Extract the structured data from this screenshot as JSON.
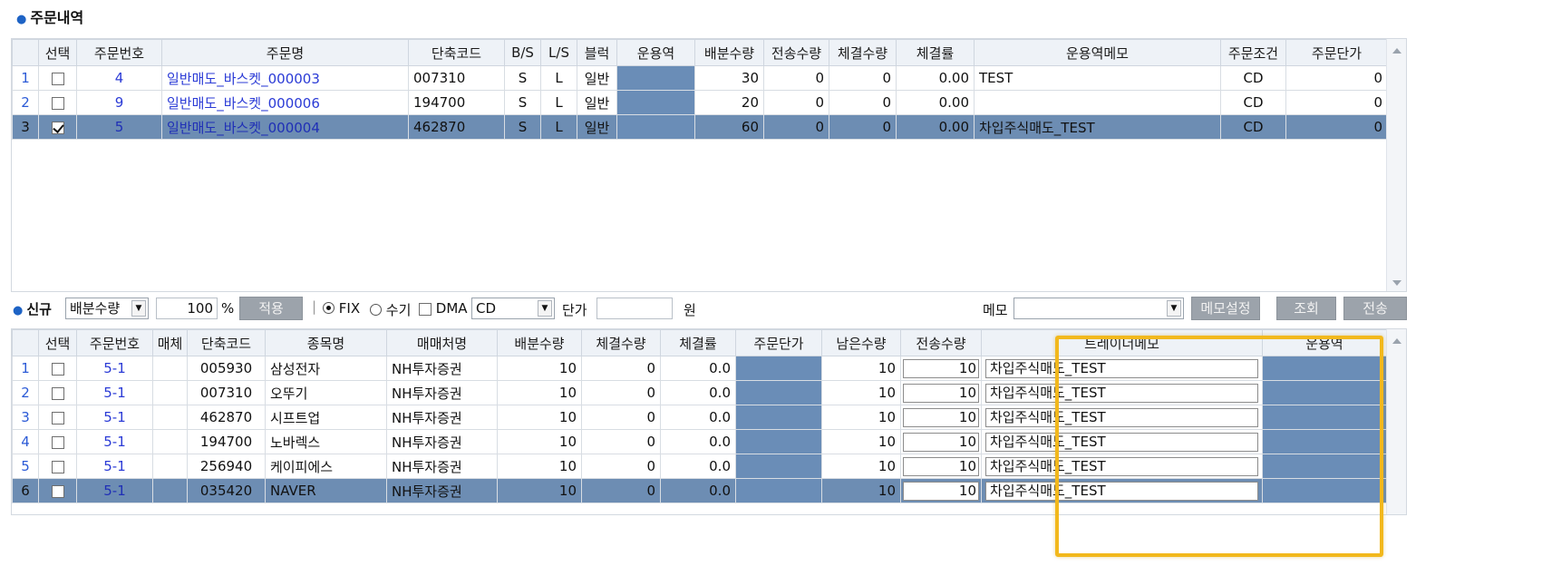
{
  "section_title": "주문내역",
  "grid1": {
    "headers": [
      "선택",
      "주문번호",
      "주문명",
      "단축코드",
      "B/S",
      "L/S",
      "블럭",
      "운용역",
      "배분수량",
      "전송수량",
      "체결수량",
      "체결률",
      "운용역메모",
      "주문조건",
      "주문단가"
    ],
    "rows": [
      {
        "idx": "1",
        "checked": false,
        "order_no": "4",
        "order_name": "일반매도_바스켓_000003",
        "code": "007310",
        "bs": "S",
        "ls": "L",
        "block": "일반",
        "manager": "",
        "alloc": "30",
        "sent": "0",
        "filled": "0",
        "rate": "0.00",
        "memo": "TEST",
        "cond": "CD",
        "price": "0"
      },
      {
        "idx": "2",
        "checked": false,
        "order_no": "9",
        "order_name": "일반매도_바스켓_000006",
        "code": "194700",
        "bs": "S",
        "ls": "L",
        "block": "일반",
        "manager": "",
        "alloc": "20",
        "sent": "0",
        "filled": "0",
        "rate": "0.00",
        "memo": "",
        "cond": "CD",
        "price": "0"
      },
      {
        "idx": "3",
        "checked": true,
        "order_no": "5",
        "order_name": "일반매도_바스켓_000004",
        "code": "462870",
        "bs": "S",
        "ls": "L",
        "block": "일반",
        "manager": "",
        "alloc": "60",
        "sent": "0",
        "filled": "0",
        "rate": "0.00",
        "memo": "차입주식매도_TEST",
        "cond": "CD",
        "price": "0"
      }
    ]
  },
  "toolbar": {
    "new_label": "신규",
    "alloc_select": "배분수량",
    "percent_value": "100",
    "percent_sign": "%",
    "apply_button": "적용",
    "fix_label": "FIX",
    "manual_label": "수기",
    "dma_label": "DMA",
    "cond_select": "CD",
    "price_label": "단가",
    "price_value": "",
    "won_label": "원",
    "memo_label": "메모",
    "memo_select": "",
    "memo_set_button": "메모설정",
    "search_button": "조회",
    "send_button": "전송"
  },
  "grid2": {
    "headers": [
      "선택",
      "주문번호",
      "매체",
      "단축코드",
      "종목명",
      "매매처명",
      "배분수량",
      "체결수량",
      "체결률",
      "주문단가",
      "남은수량",
      "전송수량",
      "트레이더메모",
      "운용역"
    ],
    "rows": [
      {
        "idx": "1",
        "checked": false,
        "order_no": "5-1",
        "media": "",
        "code": "005930",
        "name": "삼성전자",
        "broker": "NH투자증권",
        "alloc": "10",
        "filled": "0",
        "rate": "0.0",
        "price": "",
        "remain": "10",
        "send": "10",
        "memo": "차입주식매도_TEST",
        "manager": ""
      },
      {
        "idx": "2",
        "checked": false,
        "order_no": "5-1",
        "media": "",
        "code": "007310",
        "name": "오뚜기",
        "broker": "NH투자증권",
        "alloc": "10",
        "filled": "0",
        "rate": "0.0",
        "price": "",
        "remain": "10",
        "send": "10",
        "memo": "차입주식매도_TEST",
        "manager": ""
      },
      {
        "idx": "3",
        "checked": false,
        "order_no": "5-1",
        "media": "",
        "code": "462870",
        "name": "시프트업",
        "broker": "NH투자증권",
        "alloc": "10",
        "filled": "0",
        "rate": "0.0",
        "price": "",
        "remain": "10",
        "send": "10",
        "memo": "차입주식매도_TEST",
        "manager": ""
      },
      {
        "idx": "4",
        "checked": false,
        "order_no": "5-1",
        "media": "",
        "code": "194700",
        "name": "노바렉스",
        "broker": "NH투자증권",
        "alloc": "10",
        "filled": "0",
        "rate": "0.0",
        "price": "",
        "remain": "10",
        "send": "10",
        "memo": "차입주식매도_TEST",
        "manager": ""
      },
      {
        "idx": "5",
        "checked": false,
        "order_no": "5-1",
        "media": "",
        "code": "256940",
        "name": "케이피에스",
        "broker": "NH투자증권",
        "alloc": "10",
        "filled": "0",
        "rate": "0.0",
        "price": "",
        "remain": "10",
        "send": "10",
        "memo": "차입주식매도_TEST",
        "manager": ""
      },
      {
        "idx": "6",
        "checked": false,
        "order_no": "5-1",
        "media": "",
        "code": "035420",
        "name": "NAVER",
        "broker": "NH투자증권",
        "alloc": "10",
        "filled": "0",
        "rate": "0.0",
        "price": "",
        "remain": "10",
        "send": "10",
        "memo": "차입주식매도_TEST",
        "manager": ""
      }
    ]
  },
  "colors": {
    "selected_row": "#6d8db3",
    "blue_block": "#6a8db7",
    "highlight": "#f2b81c",
    "header_bg": "#eef2f7"
  }
}
